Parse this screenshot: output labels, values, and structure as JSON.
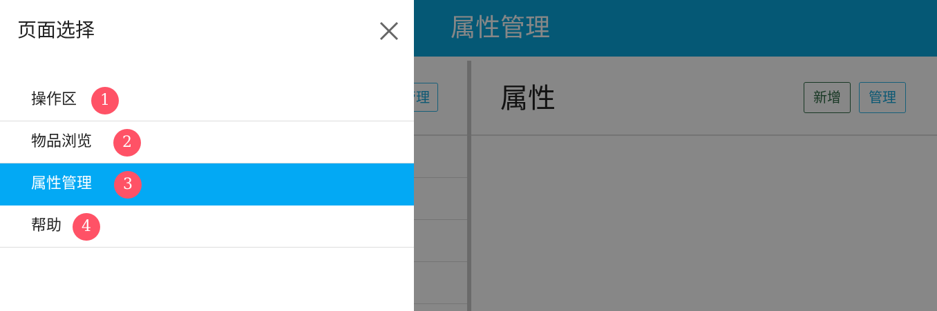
{
  "header": {
    "title": "属性管理"
  },
  "left_panel": {
    "manage_button": "管理"
  },
  "right_panel": {
    "title": "属性",
    "add_button": "新增",
    "manage_button": "管理"
  },
  "drawer": {
    "title": "页面选择",
    "close_icon": "close-icon",
    "items": [
      {
        "label": "操作区",
        "badge": "1",
        "active": false
      },
      {
        "label": "物品浏览",
        "badge": "2",
        "active": false
      },
      {
        "label": "属性管理",
        "badge": "3",
        "active": true
      },
      {
        "label": "帮助",
        "badge": "4",
        "active": false
      }
    ]
  },
  "colors": {
    "header": "#0aa6dd",
    "active_item": "#03a9f4",
    "badge": "#ff5266",
    "overlay": "rgba(0,0,0,0.47)"
  }
}
